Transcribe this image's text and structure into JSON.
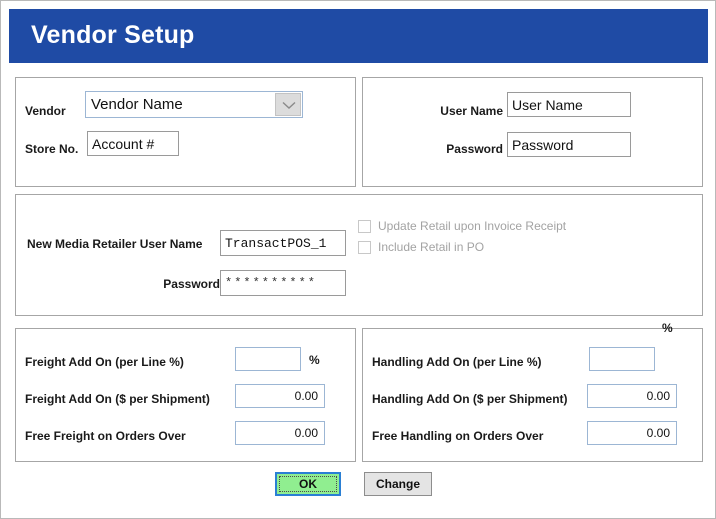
{
  "window": {
    "title": "Vendor Setup"
  },
  "vendor_panel": {
    "vendor_label": "Vendor",
    "vendor_value": "Vendor Name",
    "dropdown_icon": "chevron-down-icon",
    "store_label": "Store No.",
    "store_value": "Account #"
  },
  "credentials_panel": {
    "username_label": "User Name",
    "username_value": "User Name",
    "password_label": "Password",
    "password_value": "Password"
  },
  "retailer_panel": {
    "username_label": "New Media Retailer User Name",
    "username_value": "TransactPOS_1",
    "password_label": "Password",
    "password_value": "**********",
    "checkboxes": [
      {
        "label": "Update Retail upon Invoice Receipt",
        "checked": false
      },
      {
        "label": "Include Retail in PO",
        "checked": false
      }
    ]
  },
  "freight_panel": {
    "rows": [
      {
        "label": "Freight Add On (per Line %)",
        "value": "",
        "suffix": "%"
      },
      {
        "label": "Freight Add On ($ per Shipment)",
        "value": "0.00",
        "suffix": ""
      },
      {
        "label": "Free Freight on Orders Over",
        "value": "0.00",
        "suffix": ""
      }
    ]
  },
  "handling_panel": {
    "stray_percent": "%",
    "rows": [
      {
        "label": "Handling Add On (per Line %)",
        "value": "",
        "suffix": ""
      },
      {
        "label": "Handling Add On ($ per Shipment)",
        "value": "0.00",
        "suffix": ""
      },
      {
        "label": "Free Handling on Orders Over",
        "value": "0.00",
        "suffix": ""
      }
    ]
  },
  "footer": {
    "ok_label": "OK",
    "change_label": "Change"
  },
  "colors": {
    "titlebar": "#1f4ba5",
    "ok_fill": "#90ee90",
    "ok_focus_border": "#2a7fd4",
    "panel_border": "#a6a6a6",
    "input_blue_border": "#9cb6d4"
  }
}
